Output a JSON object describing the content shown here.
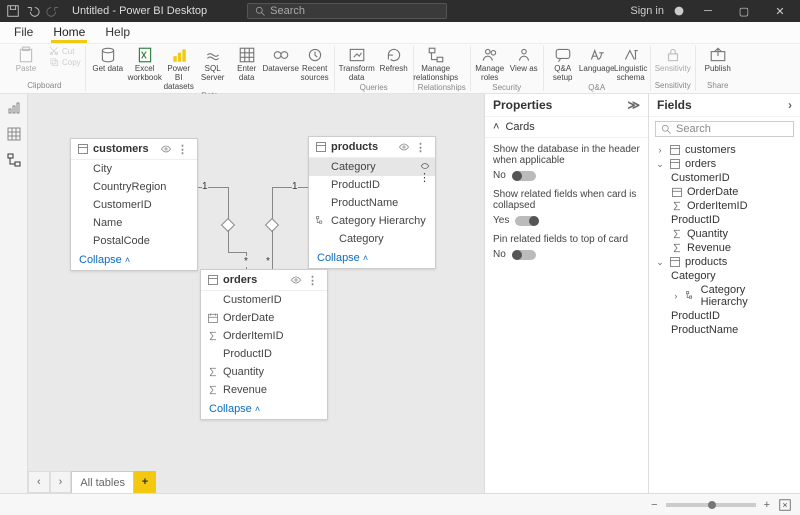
{
  "titlebar": {
    "title": "Untitled - Power BI Desktop",
    "search_placeholder": "Search",
    "signin": "Sign in"
  },
  "tabs": {
    "file": "File",
    "home": "Home",
    "help": "Help"
  },
  "ribbon": {
    "clipboard": {
      "paste": "Paste",
      "cut": "Cut",
      "copy": "Copy",
      "label": "Clipboard"
    },
    "data": {
      "get": "Get data",
      "excel": "Excel workbook",
      "pbids": "Power BI datasets",
      "sql": "SQL Server",
      "enter": "Enter data",
      "dataverse": "Dataverse",
      "recent": "Recent sources",
      "label": "Data"
    },
    "queries": {
      "transform": "Transform data",
      "refresh": "Refresh",
      "label": "Queries"
    },
    "rel": {
      "manage": "Manage relationships",
      "label": "Relationships"
    },
    "sec": {
      "roles": "Manage roles",
      "view": "View as",
      "label": "Security"
    },
    "qna": {
      "qa": "Q&A setup",
      "lang": "Language",
      "schema": "Linguistic schema",
      "label": "Q&A"
    },
    "sens": {
      "s": "Sensitivity",
      "label": "Sensitivity"
    },
    "share": {
      "pub": "Publish",
      "label": "Share"
    }
  },
  "cards": {
    "customers": {
      "title": "customers",
      "fields": [
        "City",
        "CountryRegion",
        "CustomerID",
        "Name",
        "PostalCode"
      ],
      "collapse": "Collapse"
    },
    "products": {
      "title": "products",
      "fields": [
        "Category",
        "ProductID",
        "ProductName",
        "Category Hierarchy",
        "Category"
      ],
      "collapse": "Collapse"
    },
    "orders": {
      "title": "orders",
      "fields": [
        "CustomerID",
        "OrderDate",
        "OrderItemID",
        "ProductID",
        "Quantity",
        "Revenue"
      ],
      "collapse": "Collapse"
    }
  },
  "props": {
    "title": "Properties",
    "cards": "Cards",
    "opt1": "Show the database in the header when applicable",
    "opt1v": "No",
    "opt2": "Show related fields when card is collapsed",
    "opt2v": "Yes",
    "opt3": "Pin related fields to top of card",
    "opt3v": "No"
  },
  "fieldsPanel": {
    "title": "Fields",
    "search_placeholder": "Search",
    "customers": "customers",
    "orders": "orders",
    "products": "products",
    "o": [
      "CustomerID",
      "OrderDate",
      "OrderItemID",
      "ProductID",
      "Quantity",
      "Revenue"
    ],
    "p": [
      "Category",
      "Category Hierarchy",
      "ProductID",
      "ProductName"
    ]
  },
  "footer": {
    "alltables": "All tables"
  }
}
